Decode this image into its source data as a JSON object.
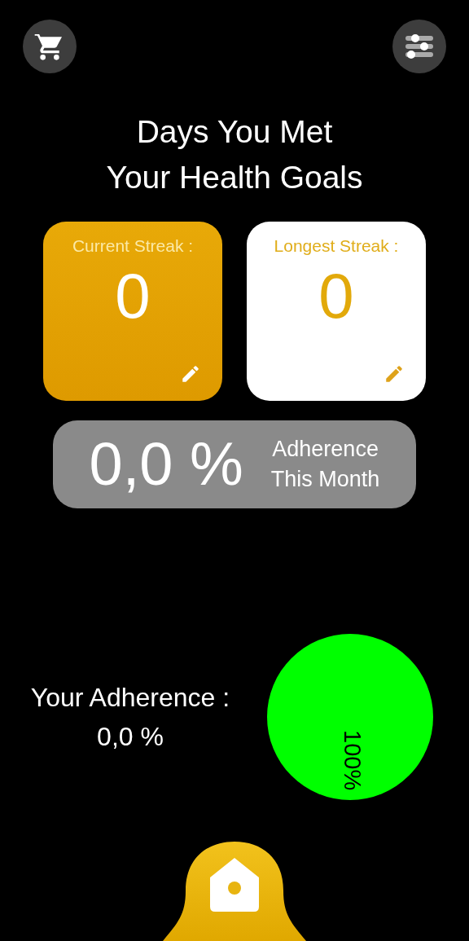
{
  "title": {
    "line1": "Days You Met",
    "line2": "Your Health Goals"
  },
  "streaks": [
    {
      "kind": "filled",
      "label": "Current Streak :",
      "value": "0"
    },
    {
      "kind": "outlined",
      "label": "Longest Streak :",
      "value": "0"
    }
  ],
  "monthly": {
    "value": "0,0 %",
    "label_line1": "Adherence",
    "label_line2": "This Month"
  },
  "adherence": {
    "label": "Your Adherence :",
    "value": "0,0 %",
    "chart_data": {
      "type": "pie",
      "series": [
        {
          "color": "#00ff00",
          "values": [
            100
          ]
        }
      ],
      "value_labels": [
        "100%"
      ]
    }
  }
}
